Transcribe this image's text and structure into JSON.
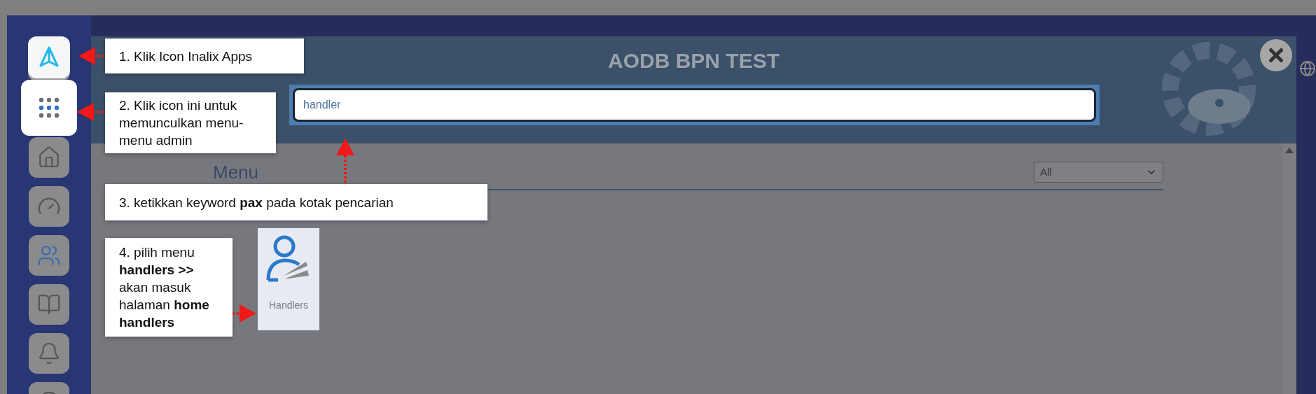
{
  "sidebar": {
    "items": [
      {
        "kind": "app",
        "highlighted": true
      },
      {
        "kind": "grid",
        "highlighted": true
      },
      {
        "kind": "home",
        "highlighted": false
      },
      {
        "kind": "gauge",
        "highlighted": false
      },
      {
        "kind": "users",
        "highlighted": false
      },
      {
        "kind": "book",
        "highlighted": false
      },
      {
        "kind": "bell",
        "highlighted": false
      },
      {
        "kind": "circle",
        "highlighted": false
      }
    ]
  },
  "header": {
    "title": "AODB BPN TEST"
  },
  "search": {
    "value": "handler"
  },
  "menu": {
    "title": "Menu",
    "filter": "All"
  },
  "results": [
    {
      "label": "Handlers"
    }
  ],
  "annotations": [
    {
      "text": "1. Klik Icon Inalix Apps"
    },
    {
      "text": "2. Klik icon ini untuk memunculkan menu-menu admin"
    },
    {
      "text": "3. ketikkan keyword **pax** pada kotak pencarian"
    },
    {
      "text": "4. pilih menu **handlers >>** akan masuk halaman **home handlers**"
    }
  ]
}
